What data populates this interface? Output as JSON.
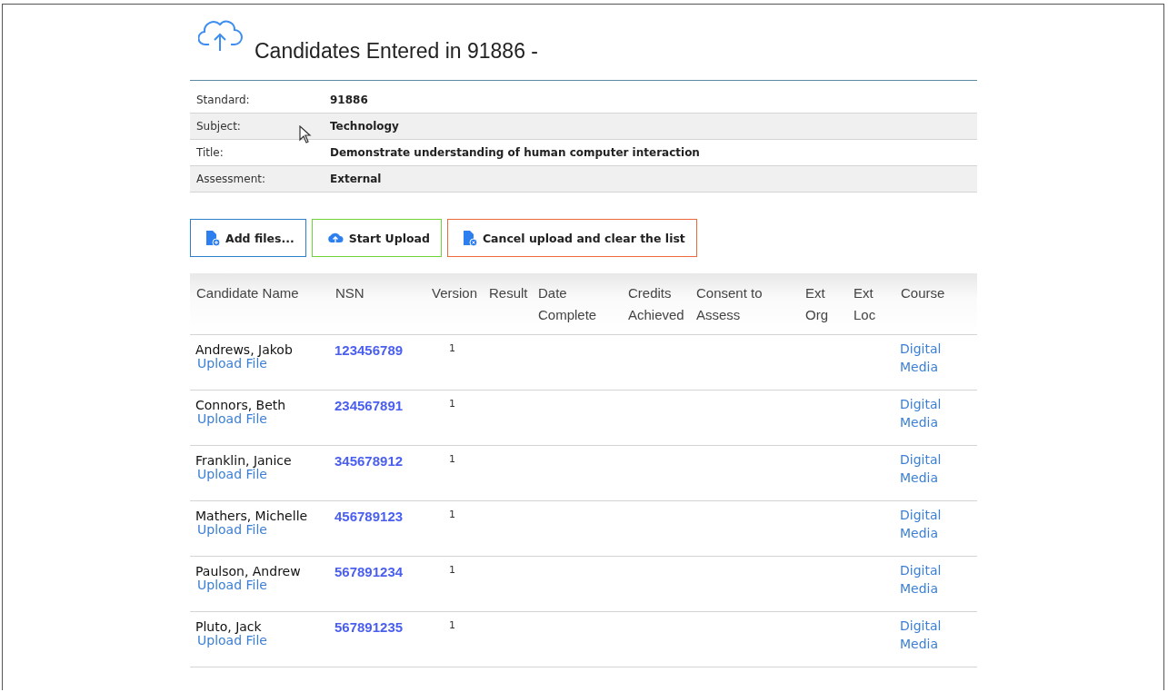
{
  "title": "Candidates Entered in 91886 -",
  "details": [
    {
      "label": "Standard:",
      "value": "91886"
    },
    {
      "label": "Subject:",
      "value": "Technology"
    },
    {
      "label": "Title:",
      "value": "Demonstrate understanding of human computer interaction"
    },
    {
      "label": "Assessment:",
      "value": "External"
    }
  ],
  "buttons": [
    {
      "kind": "add",
      "label": "Add files..."
    },
    {
      "kind": "upload",
      "label": "Start Upload"
    },
    {
      "kind": "cancel",
      "label": "Cancel upload and clear the list"
    }
  ],
  "table": {
    "columns": [
      [
        "Candidate Name"
      ],
      [
        "NSN"
      ],
      [
        "Version"
      ],
      [
        "Result"
      ],
      [
        "Date",
        "Complete"
      ],
      [
        "Credits",
        "Achieved"
      ],
      [
        "Consent to",
        "Assess"
      ],
      [
        "Ext",
        "Org"
      ],
      [
        "Ext",
        "Loc"
      ],
      [
        "Course"
      ]
    ],
    "rows": [
      {
        "name": "Andrews, Jakob",
        "link": "Upload File",
        "nsn": "123456789",
        "version": "1",
        "course": [
          "Digital",
          "Media"
        ]
      },
      {
        "name": "Connors, Beth",
        "link": "Upload File",
        "nsn": "234567891",
        "version": "1",
        "course": [
          "Digital",
          "Media"
        ]
      },
      {
        "name": "Franklin, Janice",
        "link": "Upload File",
        "nsn": "345678912",
        "version": "1",
        "course": [
          "Digital",
          "Media"
        ]
      },
      {
        "name": "Mathers, Michelle",
        "link": "Upload File",
        "nsn": "456789123",
        "version": "1",
        "course": [
          "Digital",
          "Media"
        ]
      },
      {
        "name": "Paulson, Andrew",
        "link": "Upload File",
        "nsn": "567891234",
        "version": "1",
        "course": [
          "Digital",
          "Media"
        ]
      },
      {
        "name": "Pluto, Jack",
        "link": "Upload File",
        "nsn": "567891235",
        "version": "1",
        "course": [
          "Digital",
          "Media"
        ]
      }
    ]
  }
}
